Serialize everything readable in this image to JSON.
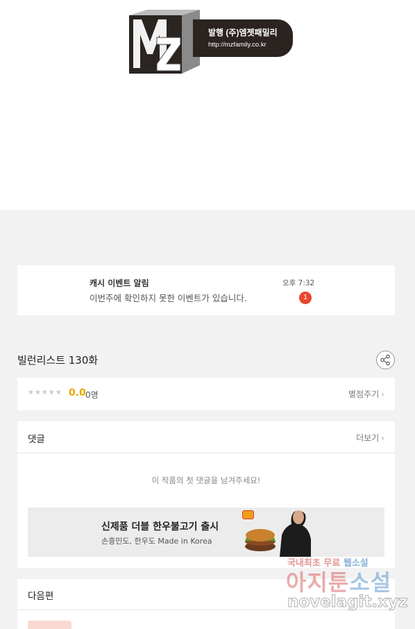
{
  "publisher": {
    "logo_letters": "MZ",
    "name": "발행 (주)엠젯패밀리",
    "url": "http://mzfamily.co.kr"
  },
  "notice": {
    "title": "캐시 이벤트 알림",
    "body": "이번주에 확인하지 못한 이벤트가 있습니다.",
    "time": "오후 7:32",
    "badge_count": "1"
  },
  "episode": {
    "title": "빌런리스트 130화",
    "share_icon": "share-icon"
  },
  "rating": {
    "stars": "★★★★★",
    "score": "0.0",
    "count": "0명",
    "rate_label": "별점주기",
    "score_color": "#e8a800"
  },
  "comments": {
    "title": "댓글",
    "more_label": "더보기",
    "empty_message": "이 작품의 첫 댓글을 남겨주세요!"
  },
  "ad": {
    "headline": "신제품 더블 한우불고기 출시",
    "subline": "손흥민도, 한우도 Made in Korea",
    "image_icon": "burger-ad-image"
  },
  "next_episode": {
    "title": "다음편"
  },
  "watermark": {
    "line1_prefix": "국내최초 무료 ",
    "line1_highlight": "웹소설",
    "line2_prefix": "아지툰",
    "line2_highlight": "소설",
    "line3": "novelagit.xyz"
  },
  "colors": {
    "badge": "#e8482c",
    "background": "#f2f2f2"
  }
}
